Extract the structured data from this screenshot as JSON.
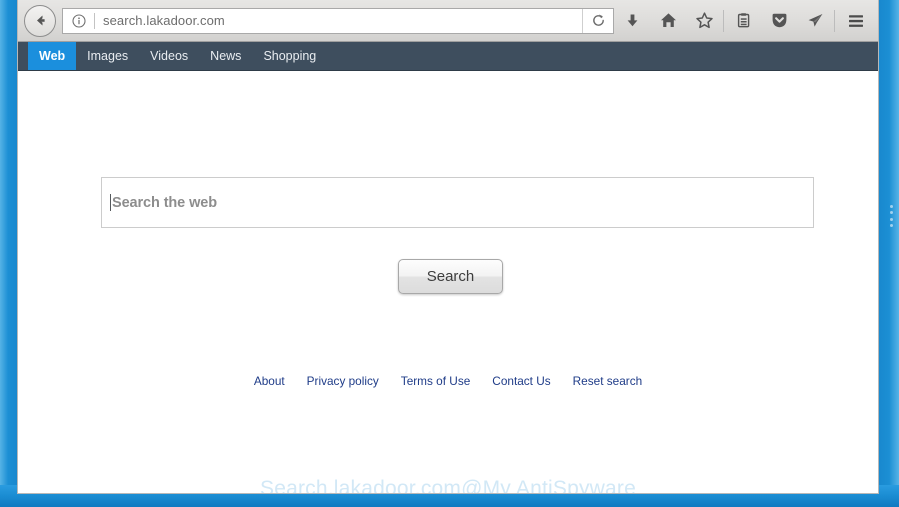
{
  "browser": {
    "back_title": "Back",
    "url": "search.lakadoor.com",
    "info_icon": "info-circle-icon",
    "reload_title": "Reload",
    "toolbar_icons": [
      {
        "name": "downloads-icon",
        "label": "Downloads"
      },
      {
        "name": "home-icon",
        "label": "Home"
      },
      {
        "name": "bookmark-star-icon",
        "label": "Bookmark"
      },
      {
        "name": "reading-list-icon",
        "label": "Reading list"
      },
      {
        "name": "pocket-icon",
        "label": "Pocket"
      },
      {
        "name": "send-icon",
        "label": "Send"
      },
      {
        "name": "hamburger-menu-icon",
        "label": "Open menu"
      }
    ]
  },
  "site_nav": {
    "items": [
      {
        "label": "Web",
        "active": true
      },
      {
        "label": "Images",
        "active": false
      },
      {
        "label": "Videos",
        "active": false
      },
      {
        "label": "News",
        "active": false
      },
      {
        "label": "Shopping",
        "active": false
      }
    ]
  },
  "search": {
    "placeholder": "Search the web",
    "value": "",
    "button_label": "Search"
  },
  "footer": {
    "links": [
      {
        "label": "About"
      },
      {
        "label": "Privacy policy"
      },
      {
        "label": "Terms of Use"
      },
      {
        "label": "Contact Us"
      },
      {
        "label": "Reset search"
      }
    ]
  },
  "watermark": {
    "text": "Search.lakadoor.com@My AntiSpyware"
  },
  "colors": {
    "nav_background": "#3e4e5e",
    "nav_active": "#1b8fdd",
    "frame_blue": "#1c8fd4",
    "link_blue": "#1f3c88",
    "watermark_blue": "#d2e8f6"
  }
}
